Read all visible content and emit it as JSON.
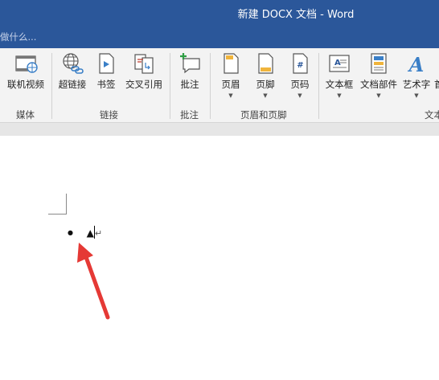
{
  "window": {
    "title": "新建 DOCX 文档 - Word",
    "tell_me": "做什么..."
  },
  "ribbon": {
    "groups": [
      {
        "label": "媒体",
        "buttons": [
          {
            "label": "联机视频"
          }
        ]
      },
      {
        "label": "链接",
        "buttons": [
          {
            "label": "超链接"
          },
          {
            "label": "书签"
          },
          {
            "label": "交叉引用"
          }
        ]
      },
      {
        "label": "批注",
        "buttons": [
          {
            "label": "批注"
          }
        ]
      },
      {
        "label": "页眉和页脚",
        "buttons": [
          {
            "label": "页眉"
          },
          {
            "label": "页脚"
          },
          {
            "label": "页码"
          }
        ]
      },
      {
        "label": "文本",
        "buttons": [
          {
            "label": "文本框"
          },
          {
            "label": "文档部件"
          },
          {
            "label": "艺术字"
          },
          {
            "label": "首"
          }
        ]
      }
    ]
  },
  "document": {
    "bullet": "●",
    "symbol": "▲",
    "paragraph_mark": "↵"
  },
  "colors": {
    "title_bar": "#2b579a",
    "annotation_arrow": "#e53935"
  }
}
